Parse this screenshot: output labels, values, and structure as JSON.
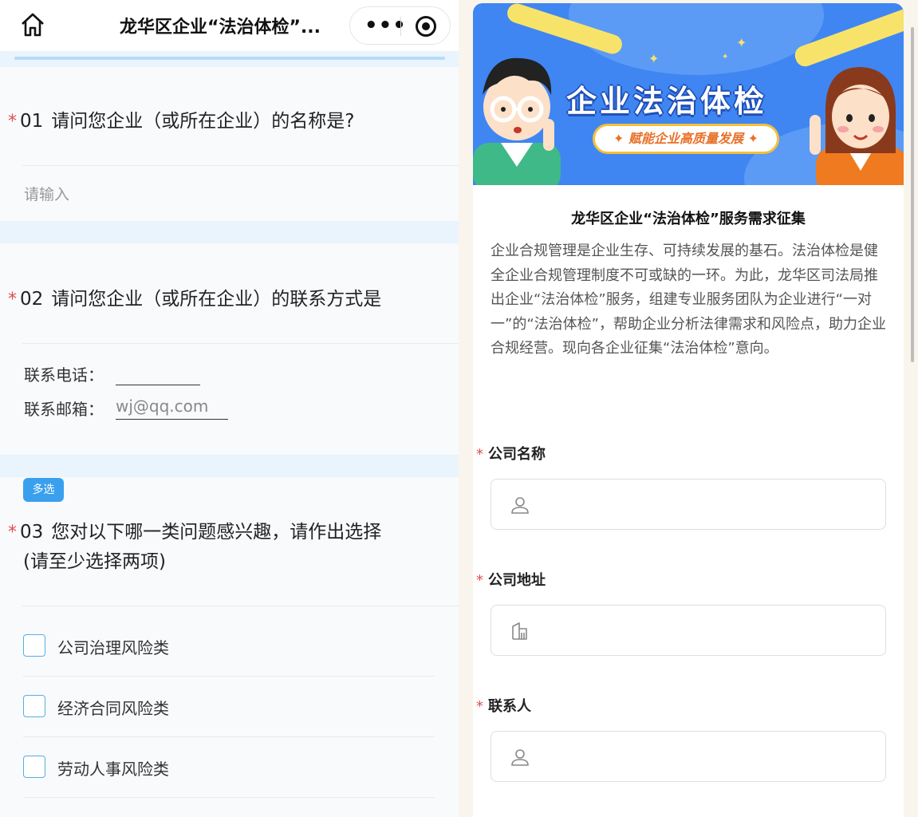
{
  "left": {
    "nav_title": "龙华区企业“法治体检”...",
    "q1": {
      "number": "01",
      "title": "请问您企业（或所在企业）的名称是?",
      "placeholder": "请输入"
    },
    "q2": {
      "number": "02",
      "title": "请问您企业（或所在企业）的联系方式是",
      "phone_label": "联系电话：",
      "email_label": "联系邮箱：",
      "email_placeholder": "wj@qq.com"
    },
    "q3": {
      "tag": "多选",
      "number": "03",
      "title_line1": "您对以下哪一类问题感兴趣，请作出选择",
      "title_line2": "(请至少选择两项)",
      "options": [
        "公司治理风险类",
        "经济合同风险类",
        "劳动人事风险类"
      ]
    }
  },
  "right": {
    "banner": {
      "headline": "企业法治体检",
      "slogan": "赋能企业高质量发展"
    },
    "form_title": "龙华区企业“法治体检”服务需求征集",
    "intro": "企业合规管理是企业生存、可持续发展的基石。法治体检是健全企业合规管理制度不可或缺的一环。为此，龙华区司法局推出企业“法治体检”服务，组建专业服务团队为企业进行“一对一”的“法治体检”，帮助企业分析法律需求和风险点，助力企业合规经营。现向各企业征集“法治体检”意向。",
    "fields": [
      {
        "label": "公司名称",
        "icon": "person-icon"
      },
      {
        "label": "公司地址",
        "icon": "building-icon"
      },
      {
        "label": "联系人",
        "icon": "person-icon"
      }
    ]
  },
  "colors": {
    "accent_blue": "#3aa0ee",
    "required_red": "#e34d4d",
    "banner_blue": "#3f86f2"
  }
}
